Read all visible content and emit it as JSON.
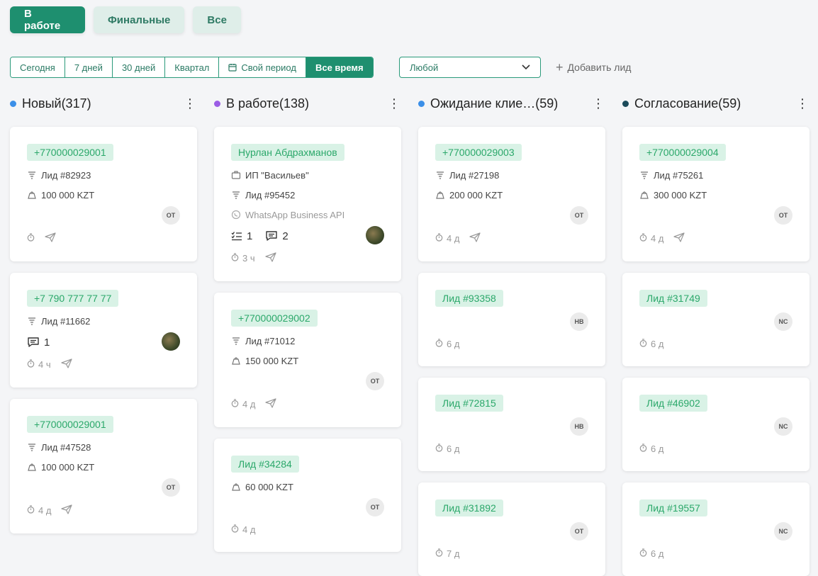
{
  "tabs": [
    "В работе",
    "Финальные",
    "Все"
  ],
  "period": [
    "Сегодня",
    "7 дней",
    "30 дней",
    "Квартал",
    "Свой период",
    "Все время"
  ],
  "select_value": "Любой",
  "add_lead": "Добавить лид",
  "columns": [
    {
      "title": "Новый(317)",
      "color": "#3b8fe8",
      "cards": [
        {
          "tag": "+770000029001",
          "lines": [
            {
              "icon": "funnel-icon",
              "text": "Лид #82923"
            },
            {
              "icon": "money-bag-icon",
              "text": "100 000 KZT",
              "muted": false
            }
          ],
          "avatar": "ОТ",
          "time": ""
        },
        {
          "tag": "+7 790 777 77 77",
          "lines": [
            {
              "icon": "funnel-icon",
              "text": "Лид #11662"
            }
          ],
          "comments": "1",
          "avatar": "",
          "time": "4 ч"
        },
        {
          "tag": "+770000029001",
          "lines": [
            {
              "icon": "funnel-icon",
              "text": "Лид #47528"
            },
            {
              "icon": "money-bag-icon",
              "text": "100 000 KZT"
            }
          ],
          "avatar": "ОТ",
          "time": "4 д"
        }
      ]
    },
    {
      "title": "В работе(138)",
      "color": "#9b5de5",
      "cards": [
        {
          "tag": "Нурлан Абдрахманов",
          "lines": [
            {
              "icon": "briefcase-icon",
              "text": "ИП \"Васильев\""
            },
            {
              "icon": "funnel-icon",
              "text": "Лид #95452"
            },
            {
              "icon": "whatsapp-icon",
              "text": "WhatsApp Business API",
              "muted": true
            }
          ],
          "tasks": "1",
          "comments": "2",
          "avatar": "",
          "time": "3 ч"
        },
        {
          "tag": "+770000029002",
          "lines": [
            {
              "icon": "funnel-icon",
              "text": "Лид #71012"
            },
            {
              "icon": "money-bag-icon",
              "text": "150 000 KZT"
            }
          ],
          "avatar": "ОТ",
          "time": "4 д"
        },
        {
          "tag": "Лид #34284",
          "lines": [
            {
              "icon": "money-bag-icon",
              "text": "60 000 KZT"
            }
          ],
          "avatar": "ОТ",
          "time": "4 д"
        }
      ]
    },
    {
      "title": "Ожидание клие…(59)",
      "color": "#3b8fe8",
      "cards": [
        {
          "tag": "+770000029003",
          "lines": [
            {
              "icon": "funnel-icon",
              "text": "Лид #27198"
            },
            {
              "icon": "money-bag-icon",
              "text": "200 000 KZT"
            }
          ],
          "avatar": "ОТ",
          "time": "4 д"
        },
        {
          "tag": "Лид #93358",
          "lines": [],
          "avatar": "НВ",
          "time": "6 д"
        },
        {
          "tag": "Лид #72815",
          "lines": [],
          "avatar": "НВ",
          "time": "6 д"
        },
        {
          "tag": "Лид #31892",
          "lines": [],
          "avatar": "ОТ",
          "time": "7 д"
        }
      ]
    },
    {
      "title": "Согласование(59)",
      "color": "#1b4a5a",
      "cards": [
        {
          "tag": "+770000029004",
          "lines": [
            {
              "icon": "funnel-icon",
              "text": "Лид #75261"
            },
            {
              "icon": "money-bag-icon",
              "text": "300 000 KZT"
            }
          ],
          "avatar": "ОТ",
          "time": "4 д"
        },
        {
          "tag": "Лид #31749",
          "lines": [],
          "avatar": "NC",
          "time": "6 д"
        },
        {
          "tag": "Лид #46902",
          "lines": [],
          "avatar": "NC",
          "time": "6 д"
        },
        {
          "tag": "Лид #19557",
          "lines": [],
          "avatar": "NC",
          "time": "6 д"
        }
      ]
    }
  ]
}
